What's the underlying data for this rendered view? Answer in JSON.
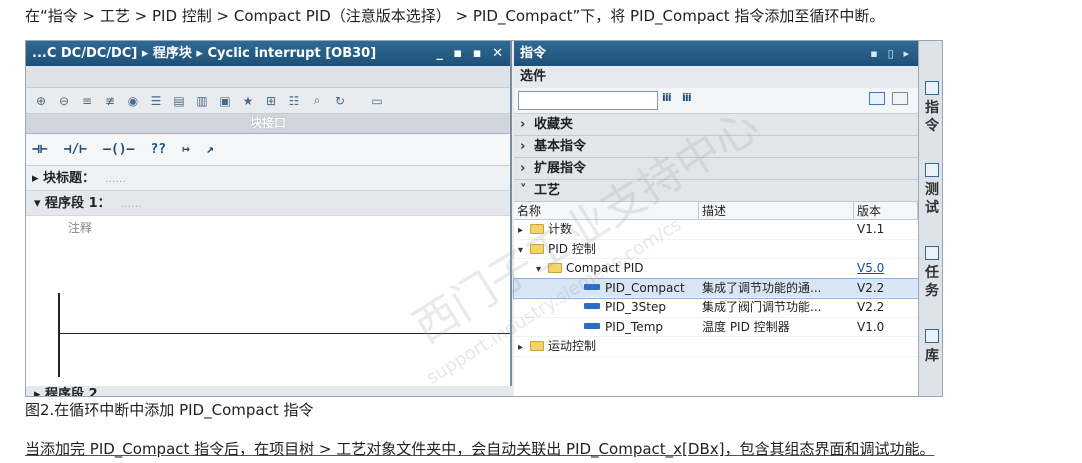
{
  "captions": {
    "top": "在“指令 > 工艺 > PID 控制 > Compact PID（注意版本选择） > PID_Compact”下，将 PID_Compact 指令添加至循环中断。",
    "figure": "图2.在循环中断中添加 PID_Compact 指令",
    "bottom": "当添加完 PID_Compact 指令后，在项目树 > 工艺对象文件夹中，会自动关联出 PID_Compact_x[DBx]，包含其组态界面和调试功能。"
  },
  "editor": {
    "title": "...C DC/DC/DC] ▸ 程序块 ▸ Cyclic interrupt [OB30]",
    "window_buttons": "_ ▪ ▪ ✕",
    "interface_label": "块接口",
    "ladder_tools": [
      "⊣⊢",
      "⊣/⊢",
      "–()–",
      "??",
      "↦",
      "↗"
    ],
    "block_title_label": "▸ 块标题：",
    "block_title_dots": "......",
    "network_label": "▾   程序段 1：",
    "network_dots": "......",
    "comment_placeholder": "注释",
    "network2_label": "▸   程序段 2"
  },
  "panel": {
    "title": "指令",
    "options_label": "选件",
    "categories": [
      {
        "arrow": "›",
        "label": "收藏夹"
      },
      {
        "arrow": "›",
        "label": "基本指令"
      },
      {
        "arrow": "›",
        "label": "扩展指令"
      },
      {
        "arrow": "˅",
        "label": "工艺"
      }
    ],
    "columns": {
      "name": "名称",
      "desc": "描述",
      "version": "版本"
    },
    "rows": [
      {
        "tri": "▸",
        "indent": 0,
        "icon": "folder",
        "name": "计数",
        "desc": "",
        "version": "V1.1"
      },
      {
        "tri": "▾",
        "indent": 0,
        "icon": "folder",
        "name": "PID 控制",
        "desc": "",
        "version": ""
      },
      {
        "tri": "▾",
        "indent": 1,
        "icon": "folder",
        "name": "Compact PID",
        "desc": "",
        "version": "V5.0"
      },
      {
        "tri": "",
        "indent": 3,
        "icon": "block",
        "name": "PID_Compact",
        "desc": "集成了调节功能的通...",
        "version": "V2.2"
      },
      {
        "tri": "",
        "indent": 3,
        "icon": "block",
        "name": "PID_3Step",
        "desc": "集成了阀门调节功能...",
        "version": "V2.2"
      },
      {
        "tri": "",
        "indent": 3,
        "icon": "block",
        "name": "PID_Temp",
        "desc": "温度 PID 控制器",
        "version": "V1.0"
      },
      {
        "tri": "▸",
        "indent": 0,
        "icon": "folder",
        "name": "运动控制",
        "desc": "",
        "version": ""
      }
    ]
  },
  "sidetabs": [
    "指令",
    "测试",
    "任务",
    "库"
  ],
  "watermark": {
    "main": "西门子工业支持中心",
    "sub": "support.industry.siemens.com/cs"
  }
}
